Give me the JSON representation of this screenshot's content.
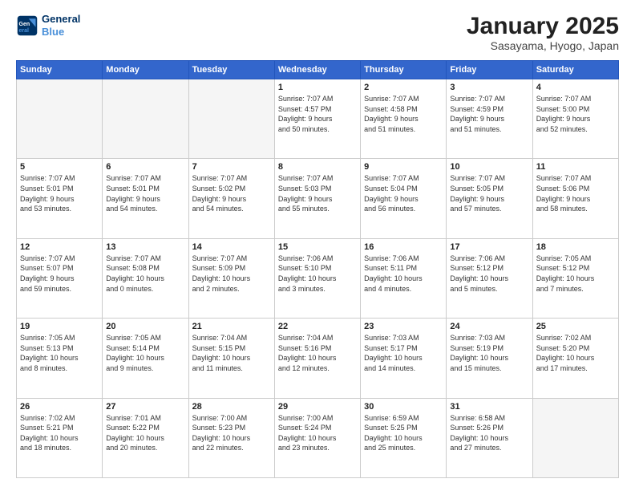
{
  "header": {
    "logo_line1": "General",
    "logo_line2": "Blue",
    "title": "January 2025",
    "subtitle": "Sasayama, Hyogo, Japan"
  },
  "days_of_week": [
    "Sunday",
    "Monday",
    "Tuesday",
    "Wednesday",
    "Thursday",
    "Friday",
    "Saturday"
  ],
  "weeks": [
    [
      {
        "day": "",
        "info": ""
      },
      {
        "day": "",
        "info": ""
      },
      {
        "day": "",
        "info": ""
      },
      {
        "day": "1",
        "info": "Sunrise: 7:07 AM\nSunset: 4:57 PM\nDaylight: 9 hours\nand 50 minutes."
      },
      {
        "day": "2",
        "info": "Sunrise: 7:07 AM\nSunset: 4:58 PM\nDaylight: 9 hours\nand 51 minutes."
      },
      {
        "day": "3",
        "info": "Sunrise: 7:07 AM\nSunset: 4:59 PM\nDaylight: 9 hours\nand 51 minutes."
      },
      {
        "day": "4",
        "info": "Sunrise: 7:07 AM\nSunset: 5:00 PM\nDaylight: 9 hours\nand 52 minutes."
      }
    ],
    [
      {
        "day": "5",
        "info": "Sunrise: 7:07 AM\nSunset: 5:01 PM\nDaylight: 9 hours\nand 53 minutes."
      },
      {
        "day": "6",
        "info": "Sunrise: 7:07 AM\nSunset: 5:01 PM\nDaylight: 9 hours\nand 54 minutes."
      },
      {
        "day": "7",
        "info": "Sunrise: 7:07 AM\nSunset: 5:02 PM\nDaylight: 9 hours\nand 54 minutes."
      },
      {
        "day": "8",
        "info": "Sunrise: 7:07 AM\nSunset: 5:03 PM\nDaylight: 9 hours\nand 55 minutes."
      },
      {
        "day": "9",
        "info": "Sunrise: 7:07 AM\nSunset: 5:04 PM\nDaylight: 9 hours\nand 56 minutes."
      },
      {
        "day": "10",
        "info": "Sunrise: 7:07 AM\nSunset: 5:05 PM\nDaylight: 9 hours\nand 57 minutes."
      },
      {
        "day": "11",
        "info": "Sunrise: 7:07 AM\nSunset: 5:06 PM\nDaylight: 9 hours\nand 58 minutes."
      }
    ],
    [
      {
        "day": "12",
        "info": "Sunrise: 7:07 AM\nSunset: 5:07 PM\nDaylight: 9 hours\nand 59 minutes."
      },
      {
        "day": "13",
        "info": "Sunrise: 7:07 AM\nSunset: 5:08 PM\nDaylight: 10 hours\nand 0 minutes."
      },
      {
        "day": "14",
        "info": "Sunrise: 7:07 AM\nSunset: 5:09 PM\nDaylight: 10 hours\nand 2 minutes."
      },
      {
        "day": "15",
        "info": "Sunrise: 7:06 AM\nSunset: 5:10 PM\nDaylight: 10 hours\nand 3 minutes."
      },
      {
        "day": "16",
        "info": "Sunrise: 7:06 AM\nSunset: 5:11 PM\nDaylight: 10 hours\nand 4 minutes."
      },
      {
        "day": "17",
        "info": "Sunrise: 7:06 AM\nSunset: 5:12 PM\nDaylight: 10 hours\nand 5 minutes."
      },
      {
        "day": "18",
        "info": "Sunrise: 7:05 AM\nSunset: 5:12 PM\nDaylight: 10 hours\nand 7 minutes."
      }
    ],
    [
      {
        "day": "19",
        "info": "Sunrise: 7:05 AM\nSunset: 5:13 PM\nDaylight: 10 hours\nand 8 minutes."
      },
      {
        "day": "20",
        "info": "Sunrise: 7:05 AM\nSunset: 5:14 PM\nDaylight: 10 hours\nand 9 minutes."
      },
      {
        "day": "21",
        "info": "Sunrise: 7:04 AM\nSunset: 5:15 PM\nDaylight: 10 hours\nand 11 minutes."
      },
      {
        "day": "22",
        "info": "Sunrise: 7:04 AM\nSunset: 5:16 PM\nDaylight: 10 hours\nand 12 minutes."
      },
      {
        "day": "23",
        "info": "Sunrise: 7:03 AM\nSunset: 5:17 PM\nDaylight: 10 hours\nand 14 minutes."
      },
      {
        "day": "24",
        "info": "Sunrise: 7:03 AM\nSunset: 5:19 PM\nDaylight: 10 hours\nand 15 minutes."
      },
      {
        "day": "25",
        "info": "Sunrise: 7:02 AM\nSunset: 5:20 PM\nDaylight: 10 hours\nand 17 minutes."
      }
    ],
    [
      {
        "day": "26",
        "info": "Sunrise: 7:02 AM\nSunset: 5:21 PM\nDaylight: 10 hours\nand 18 minutes."
      },
      {
        "day": "27",
        "info": "Sunrise: 7:01 AM\nSunset: 5:22 PM\nDaylight: 10 hours\nand 20 minutes."
      },
      {
        "day": "28",
        "info": "Sunrise: 7:00 AM\nSunset: 5:23 PM\nDaylight: 10 hours\nand 22 minutes."
      },
      {
        "day": "29",
        "info": "Sunrise: 7:00 AM\nSunset: 5:24 PM\nDaylight: 10 hours\nand 23 minutes."
      },
      {
        "day": "30",
        "info": "Sunrise: 6:59 AM\nSunset: 5:25 PM\nDaylight: 10 hours\nand 25 minutes."
      },
      {
        "day": "31",
        "info": "Sunrise: 6:58 AM\nSunset: 5:26 PM\nDaylight: 10 hours\nand 27 minutes."
      },
      {
        "day": "",
        "info": ""
      }
    ]
  ]
}
